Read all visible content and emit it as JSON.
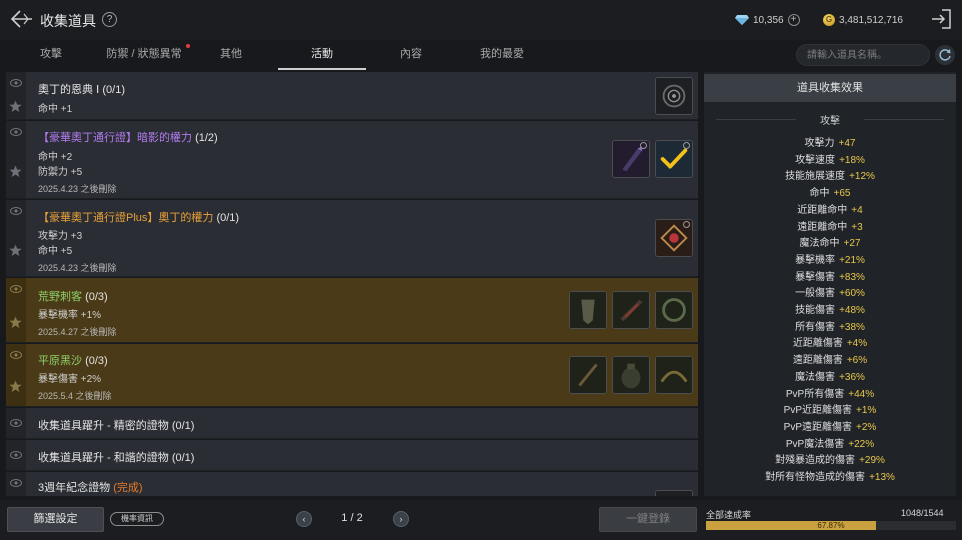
{
  "header": {
    "title": "收集道具",
    "help": "?",
    "gems": "10,356",
    "gold": "3,481,512,716",
    "gold_symbol": "G"
  },
  "tabs": [
    {
      "label": "攻擊"
    },
    {
      "label": "防禦 / 狀態異常"
    },
    {
      "label": "其他"
    },
    {
      "label": "活動"
    },
    {
      "label": "內容"
    },
    {
      "label": "我的最愛"
    }
  ],
  "search": {
    "placeholder": "請輸入道具名稱。"
  },
  "rows": [
    {
      "name": "奧丁的恩典 Ⅰ",
      "count": "(0/1)",
      "stats": [
        "命中 +1"
      ]
    },
    {
      "prefix": "【豪華奧丁通行證】",
      "name": "暗影的權力",
      "count": "(1/2)",
      "stats": [
        "命中 +2",
        "防禦力 +5"
      ],
      "expiry": "2025.4.23 之後刪除"
    },
    {
      "prefix": "【豪華奧丁通行證Plus】",
      "name": "奧丁的權力",
      "count": "(0/1)",
      "stats": [
        "攻擊力 +3",
        "命中 +5"
      ],
      "expiry": "2025.4.23 之後刪除"
    },
    {
      "name": "荒野刺客",
      "count": "(0/3)",
      "stats": [
        "暴擊機率 +1%"
      ],
      "expiry": "2025.4.27 之後刪除"
    },
    {
      "name": "平原黑沙",
      "count": "(0/3)",
      "stats": [
        "暴擊傷害 +2%"
      ],
      "expiry": "2025.5.4 之後刪除"
    },
    {
      "name": "收集道具躍升 - 精密的證物",
      "count": "(0/1)"
    },
    {
      "name": "收集道具躍升 - 和諧的證物",
      "count": "(0/1)"
    },
    {
      "name": "3週年紀念證物",
      "status": "(完成)"
    }
  ],
  "effects": {
    "header": "道具收集效果",
    "category": "攻擊",
    "lines": [
      {
        "name": "攻擊力",
        "value": "+47"
      },
      {
        "name": "攻擊速度",
        "value": "+18%"
      },
      {
        "name": "技能施展速度",
        "value": "+12%"
      },
      {
        "name": "命中",
        "value": "+65"
      },
      {
        "name": "近距離命中",
        "value": "+4"
      },
      {
        "name": "遠距離命中",
        "value": "+3"
      },
      {
        "name": "魔法命中",
        "value": "+27"
      },
      {
        "name": "暴擊機率",
        "value": "+21%"
      },
      {
        "name": "暴擊傷害",
        "value": "+83%"
      },
      {
        "name": "一般傷害",
        "value": "+60%"
      },
      {
        "name": "技能傷害",
        "value": "+48%"
      },
      {
        "name": "所有傷害",
        "value": "+38%"
      },
      {
        "name": "近距離傷害",
        "value": "+4%"
      },
      {
        "name": "遠距離傷害",
        "value": "+6%"
      },
      {
        "name": "魔法傷害",
        "value": "+36%"
      },
      {
        "name": "PvP所有傷害",
        "value": "+44%"
      },
      {
        "name": "PvP近距離傷害",
        "value": "+1%"
      },
      {
        "name": "PvP遠距離傷害",
        "value": "+2%"
      },
      {
        "name": "PvP魔法傷害",
        "value": "+22%"
      },
      {
        "name": "對殘暴造成的傷害",
        "value": "+29%"
      },
      {
        "name": "對所有怪物造成的傷害",
        "value": "+13%"
      }
    ]
  },
  "footer": {
    "filter": "篩選設定",
    "probability": "機率資訊",
    "prev": "‹",
    "next": "›",
    "page": "1 / 2",
    "register": "一鍵登錄",
    "progress_label": "全部達成率",
    "progress_count": "1048/1544",
    "progress_text": "67.87%",
    "progress_fraction": 0.6787
  },
  "colors": {
    "accent_gold": "#c9a23f",
    "value_yellow": "#e8c84a",
    "purple_title": "#b27cf0",
    "orange_title": "#e8a13a",
    "green_title": "#8fd06a",
    "event_row_bg": "#4a3a17"
  },
  "icons": [
    "back-arrow-icon",
    "help-icon",
    "gem-icon",
    "plus-icon",
    "gold-coin-icon",
    "exit-icon",
    "refresh-icon",
    "eye-icon",
    "star-icon",
    "check-icon"
  ]
}
